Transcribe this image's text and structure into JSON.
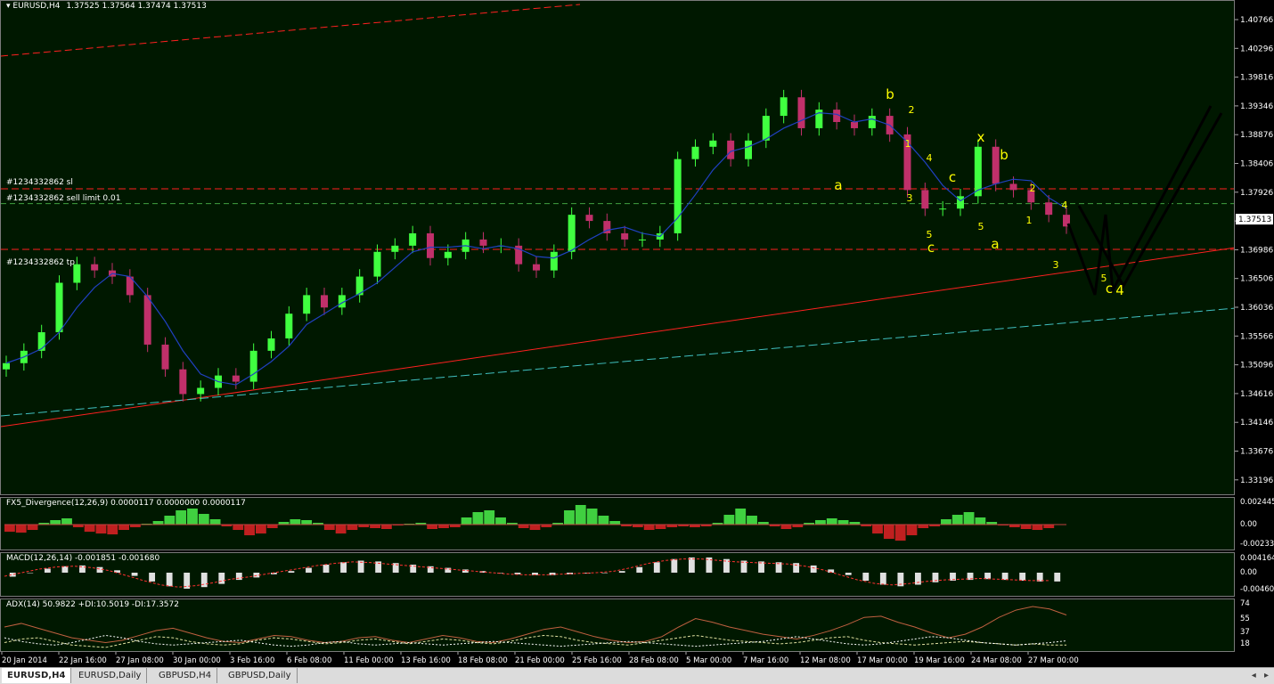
{
  "header": {
    "symbol": "EURUSD,H4",
    "ohlc": "1.37525 1.37564 1.37474 1.37513"
  },
  "orders": {
    "sl": "#1234332862 sl",
    "sell_limit": "#1234332862 sell limit 0.01",
    "tp": "#1234332862 tp"
  },
  "indicators": {
    "fx5": "FX5_Divergence(12,26,9) 0.0000117 0.0000000 0.0000117",
    "macd": "MACD(12,26,14) -0.001851 -0.001680",
    "adx": "ADX(14) 50.9822 +DI:10.5019 -DI:17.3572"
  },
  "tabs": [
    "EURUSD,H4",
    "EURUSD,Daily",
    "GBPUSD,H4",
    "GBPUSD,Daily"
  ],
  "colors": {
    "background": "#001800",
    "bull": "#40ff40",
    "bear": "#c0306a",
    "labels": "#ffff00",
    "fib_red": "#ff2020",
    "channel_cyan": "#40c0c0"
  },
  "chart_data": [
    {
      "type": "line",
      "title": "EURUSD,H4",
      "price_ticks": [
        "1.40766",
        "1.40296",
        "1.39816",
        "1.39346",
        "1.38876",
        "1.38406",
        "1.37926",
        "1.37513",
        "1.36986",
        "1.36506",
        "1.36036",
        "1.35566",
        "1.35096",
        "1.34616",
        "1.34146",
        "1.33676",
        "1.33196"
      ],
      "current_price": "1.37513",
      "ylim": [
        1.3315,
        1.409
      ],
      "x_labels": [
        "20 Jan 2014",
        "22 Jan 16:00",
        "27 Jan 08:00",
        "30 Jan 00:00",
        "3 Feb 16:00",
        "6 Feb 08:00",
        "11 Feb 00:00",
        "13 Feb 16:00",
        "18 Feb 08:00",
        "21 Feb 00:00",
        "25 Feb 16:00",
        "28 Feb 08:00",
        "5 Mar 00:00",
        "7 Mar 16:00",
        "12 Mar 08:00",
        "17 Mar 00:00",
        "19 Mar 16:00",
        "24 Mar 08:00",
        "27 Mar 00:00"
      ],
      "close": [
        1.353,
        1.355,
        1.358,
        1.366,
        1.369,
        1.368,
        1.367,
        1.364,
        1.356,
        1.352,
        1.348,
        1.349,
        1.351,
        1.35,
        1.355,
        1.357,
        1.361,
        1.364,
        1.362,
        1.364,
        1.367,
        1.371,
        1.372,
        1.374,
        1.37,
        1.371,
        1.373,
        1.372,
        1.372,
        1.369,
        1.368,
        1.371,
        1.377,
        1.376,
        1.374,
        1.373,
        1.373,
        1.374,
        1.386,
        1.388,
        1.389,
        1.386,
        1.389,
        1.393,
        1.396,
        1.391,
        1.394,
        1.392,
        1.391,
        1.393,
        1.39,
        1.381,
        1.378,
        1.378,
        1.38,
        1.388,
        1.382,
        1.381,
        1.379,
        1.377,
        1.3751
      ],
      "annotations": [
        "a",
        "b",
        "c",
        "x",
        "a",
        "b",
        "c",
        "1",
        "2",
        "3",
        "4",
        "5",
        "1",
        "2",
        "3",
        "4",
        "5",
        "5",
        "c",
        "4"
      ],
      "order_levels": {
        "sl": 1.3812,
        "sell_limit": 1.3788,
        "tp": 1.3714
      }
    },
    {
      "type": "bar",
      "title": "FX5_Divergence(12,26,9)",
      "y_ticks": [
        "0.002445",
        "0.00",
        "-0.002333"
      ],
      "ylim": [
        -0.002333,
        0.002445
      ],
      "values": [
        -0.0008,
        -0.0009,
        -0.0006,
        0.0002,
        0.0005,
        0.0007,
        -0.0003,
        -0.0008,
        -0.001,
        -0.0011,
        -0.0006,
        -0.0003,
        0.0001,
        0.0004,
        0.001,
        0.0016,
        0.0018,
        0.0012,
        0.0006,
        -0.0002,
        -0.0006,
        -0.0012,
        -0.001,
        -0.0004,
        0.0003,
        0.0006,
        0.0005,
        0.0002,
        -0.0006,
        -0.001,
        -0.0006,
        -0.0003,
        -0.0004,
        -0.0005,
        -0.0001,
        0.0001,
        0.0002,
        -0.0005,
        -0.0004,
        -0.0003,
        0.0008,
        0.0014,
        0.0016,
        0.0008,
        0.0002,
        -0.0004,
        -0.0006,
        -0.0003,
        0.0002,
        0.0016,
        0.0022,
        0.0018,
        0.001,
        0.0004,
        -0.0002,
        -0.0003,
        -0.0006,
        -0.0005,
        -0.0003,
        -0.0002,
        -0.0003,
        -0.0002,
        0.0002,
        0.0011,
        0.0018,
        0.001,
        0.0003,
        -0.0002,
        -0.0005,
        -0.0003,
        0.0002,
        0.0005,
        0.0007,
        0.0005,
        0.0003,
        -0.0002,
        -0.001,
        -0.0016,
        -0.0018,
        -0.0012,
        -0.0004,
        -0.0002,
        0.0006,
        0.0011,
        0.0014,
        0.0008,
        0.0003,
        -0.0001,
        -0.0003,
        -0.0005,
        -0.0006,
        -0.0004,
        0.0
      ]
    },
    {
      "type": "bar",
      "title": "MACD(12,26,14)",
      "y_ticks": [
        "0.004164",
        "0.00",
        "-0.004603"
      ],
      "ylim": [
        -0.004603,
        0.004164
      ],
      "values": [
        -0.001,
        0.0,
        0.001,
        0.0016,
        0.0018,
        0.0014,
        0.0006,
        -0.0008,
        -0.0022,
        -0.0034,
        -0.004,
        -0.0036,
        -0.0028,
        -0.0018,
        -0.0012,
        -0.0004,
        0.0004,
        0.0012,
        0.002,
        0.0026,
        0.003,
        0.0028,
        0.0024,
        0.002,
        0.0016,
        0.0012,
        0.0008,
        0.0004,
        0.0,
        -0.0004,
        -0.0006,
        -0.0006,
        -0.0004,
        -0.0002,
        0.0,
        0.0004,
        0.0014,
        0.0026,
        0.0034,
        0.0038,
        0.0038,
        0.0034,
        0.003,
        0.0028,
        0.0026,
        0.0024,
        0.0018,
        0.0008,
        -0.0006,
        -0.002,
        -0.003,
        -0.0034,
        -0.003,
        -0.0024,
        -0.002,
        -0.0018,
        -0.0016,
        -0.0018,
        -0.002,
        -0.0022,
        -0.0022
      ]
    },
    {
      "type": "line",
      "title": "ADX(14)",
      "y_ticks": [
        "74",
        "55",
        "37",
        "18"
      ],
      "ylim": [
        0,
        80
      ],
      "series": [
        {
          "name": "ADX(14)",
          "values": [
            40,
            46,
            38,
            30,
            22,
            18,
            14,
            18,
            26,
            34,
            38,
            30,
            22,
            16,
            14,
            20,
            26,
            24,
            18,
            14,
            16,
            22,
            24,
            18,
            14,
            20,
            26,
            22,
            16,
            14,
            20,
            28,
            36,
            40,
            32,
            24,
            18,
            14,
            16,
            24,
            40,
            54,
            48,
            40,
            34,
            28,
            24,
            20,
            26,
            34,
            44,
            56,
            58,
            48,
            40,
            30,
            22,
            28,
            40,
            56,
            68,
            74,
            70,
            60
          ]
        },
        {
          "name": "+DI",
          "values": [
            14,
            20,
            22,
            16,
            10,
            8,
            6,
            12,
            18,
            24,
            22,
            16,
            12,
            10,
            12,
            18,
            22,
            20,
            16,
            12,
            14,
            18,
            20,
            16,
            12,
            16,
            20,
            18,
            14,
            12,
            16,
            22,
            26,
            24,
            18,
            14,
            12,
            10,
            14,
            18,
            22,
            26,
            22,
            18,
            16,
            14,
            12,
            14,
            18,
            22,
            24,
            18,
            14,
            12,
            10,
            12,
            14,
            16,
            14,
            12,
            10,
            12,
            10,
            10
          ]
        },
        {
          "name": "-DI",
          "values": [
            22,
            16,
            12,
            10,
            14,
            20,
            26,
            22,
            16,
            12,
            10,
            12,
            14,
            16,
            18,
            14,
            10,
            8,
            10,
            14,
            16,
            12,
            10,
            12,
            14,
            12,
            10,
            12,
            14,
            16,
            14,
            12,
            10,
            8,
            10,
            12,
            14,
            16,
            14,
            12,
            10,
            8,
            10,
            12,
            14,
            16,
            20,
            24,
            20,
            16,
            12,
            10,
            12,
            16,
            20,
            24,
            22,
            18,
            14,
            12,
            10,
            12,
            14,
            17
          ]
        }
      ]
    }
  ]
}
